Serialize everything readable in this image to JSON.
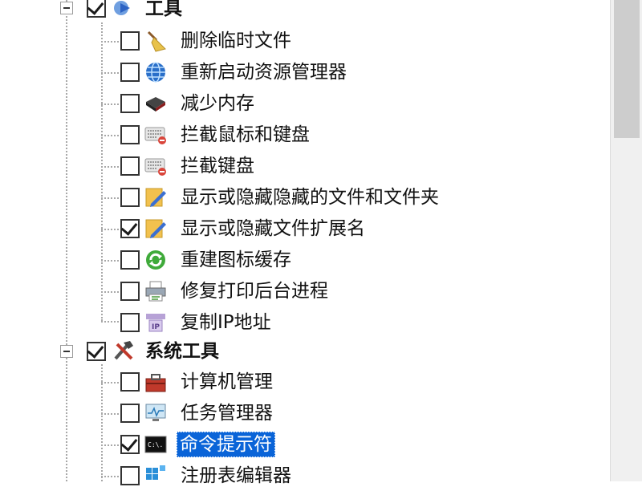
{
  "tree": {
    "groups": [
      {
        "label": "工具",
        "checked": true,
        "expanded": true,
        "icon": "arrow-icon",
        "items": [
          {
            "label": "删除临时文件",
            "checked": false,
            "icon": "broom-icon"
          },
          {
            "label": "重新启动资源管理器",
            "checked": false,
            "icon": "globe-icon"
          },
          {
            "label": "减少内存",
            "checked": false,
            "icon": "memory-chip-icon"
          },
          {
            "label": "拦截鼠标和键盘",
            "checked": false,
            "icon": "keyboard-block-icon"
          },
          {
            "label": "拦截键盘",
            "checked": false,
            "icon": "keyboard-block-icon"
          },
          {
            "label": "显示或隐藏隐藏的文件和文件夹",
            "checked": false,
            "icon": "edit-file-icon"
          },
          {
            "label": "显示或隐藏文件扩展名",
            "checked": true,
            "icon": "edit-file-icon"
          },
          {
            "label": "重建图标缓存",
            "checked": false,
            "icon": "refresh-icon"
          },
          {
            "label": "修复打印后台进程",
            "checked": false,
            "icon": "printer-icon"
          },
          {
            "label": "复制IP地址",
            "checked": false,
            "icon": "ip-address-icon"
          }
        ]
      },
      {
        "label": "系统工具",
        "checked": true,
        "expanded": true,
        "icon": "tools-icon",
        "items": [
          {
            "label": "计算机管理",
            "checked": false,
            "icon": "toolbox-icon"
          },
          {
            "label": "任务管理器",
            "checked": false,
            "icon": "monitor-icon"
          },
          {
            "label": "命令提示符",
            "checked": true,
            "icon": "command-prompt-icon",
            "selected": true
          },
          {
            "label": "注册表编辑器",
            "checked": false,
            "icon": "registry-icon"
          }
        ]
      }
    ]
  },
  "colors": {
    "selection": "#0a64d8",
    "dotted_line": "#a8a8a8",
    "scrollbar_track": "#f0f0f0",
    "scrollbar_thumb": "#cdcdcd"
  },
  "icon_text": {
    "command_prompt": "C:\\.",
    "ip": "IP"
  }
}
